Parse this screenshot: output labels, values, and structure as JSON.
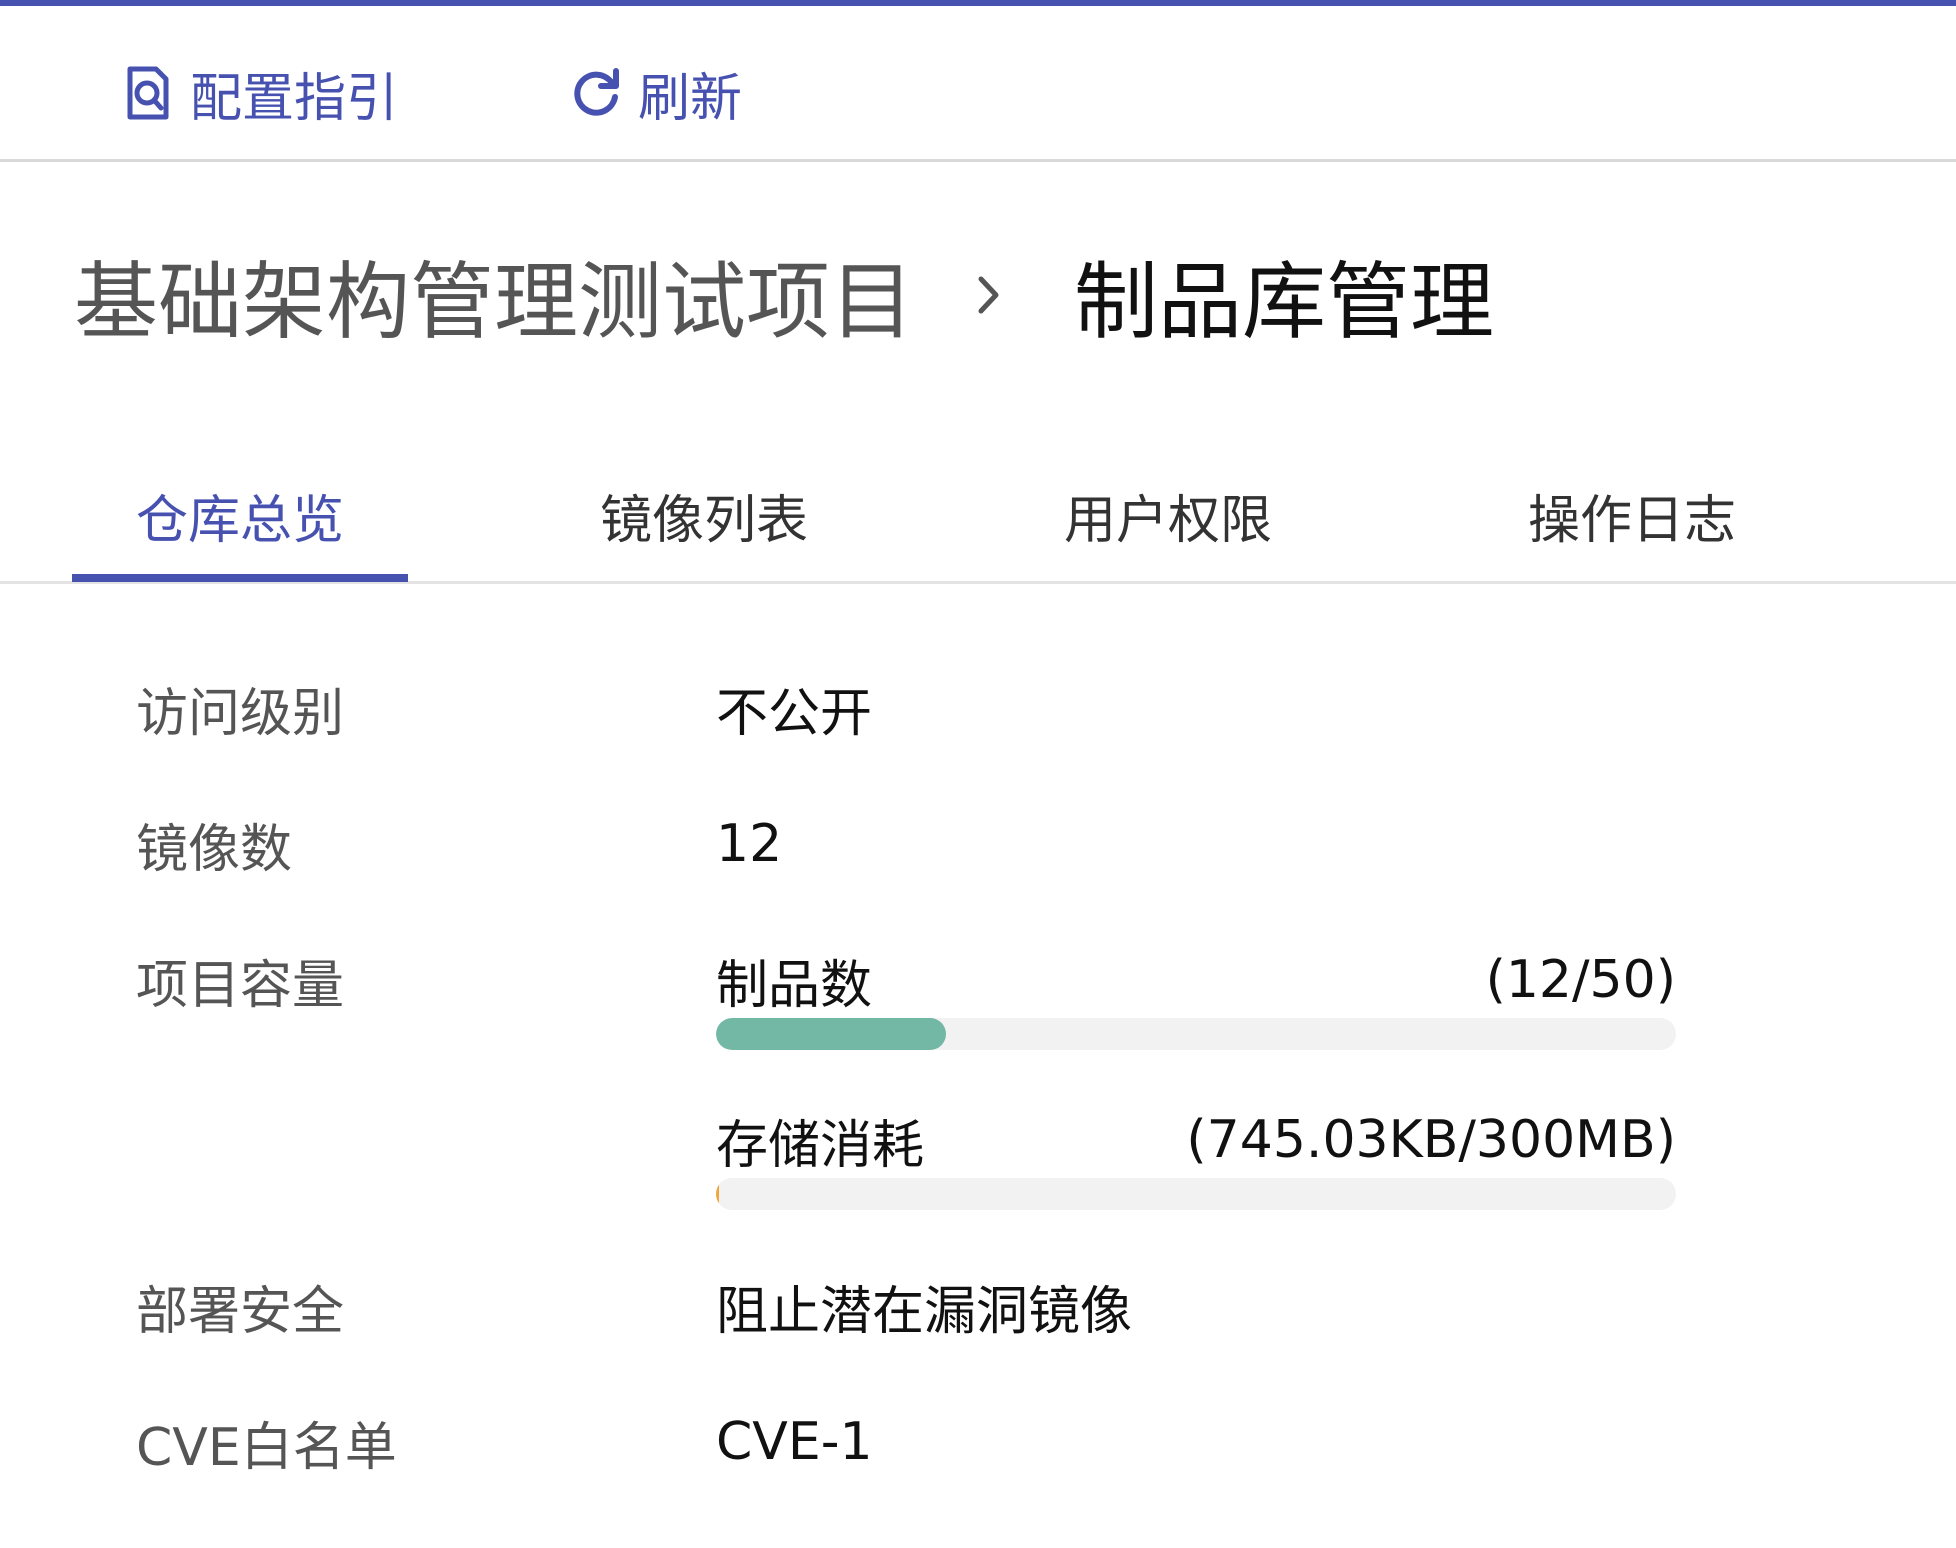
{
  "colors": {
    "accent": "#4651b0",
    "artifacts_bar": "#72b8a5",
    "storage_bar": "#f0a640"
  },
  "toolbar": {
    "guide_label": "配置指引",
    "guide_icon": "document-search-icon",
    "refresh_label": "刷新",
    "refresh_icon": "refresh-icon"
  },
  "breadcrumb": {
    "parent": "基础架构管理测试项目",
    "separator_icon": "chevron-right-icon",
    "current": "制品库管理"
  },
  "tabs": [
    {
      "label": "仓库总览",
      "active": true
    },
    {
      "label": "镜像列表",
      "active": false
    },
    {
      "label": "用户权限",
      "active": false
    },
    {
      "label": "操作日志",
      "active": false
    }
  ],
  "overview": {
    "access_level": {
      "label": "访问级别",
      "value": "不公开"
    },
    "image_count": {
      "label": "镜像数",
      "value": "12"
    },
    "capacity": {
      "label": "项目容量",
      "artifacts": {
        "label": "制品数",
        "usage": "(12/50)",
        "fraction": 0.24
      },
      "storage": {
        "label": "存储消耗",
        "usage": "(745.03KB/300MB)",
        "fraction": 0.0024
      }
    },
    "deploy_security": {
      "label": "部署安全",
      "value": "阻止潜在漏洞镜像"
    },
    "cve_whitelist": {
      "label": "CVE白名单",
      "value": "CVE-1"
    }
  }
}
